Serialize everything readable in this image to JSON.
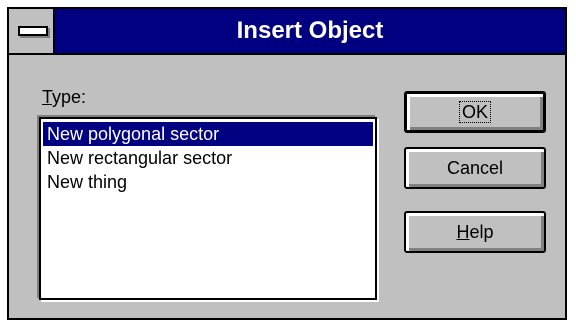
{
  "window": {
    "title": "Insert Object"
  },
  "type_label": {
    "accel": "T",
    "rest": "ype:"
  },
  "type_list": {
    "items": [
      "New polygonal sector",
      "New rectangular sector",
      "New thing"
    ],
    "selected_index": 0
  },
  "buttons": {
    "ok_label": "OK",
    "cancel_label": "Cancel",
    "help_accel": "H",
    "help_rest": "elp"
  },
  "colors": {
    "titlebar": "#000080",
    "dialog_face": "#c0c0c0",
    "selection": "#000080"
  },
  "icons": {
    "system_menu": "system-menu-icon"
  }
}
